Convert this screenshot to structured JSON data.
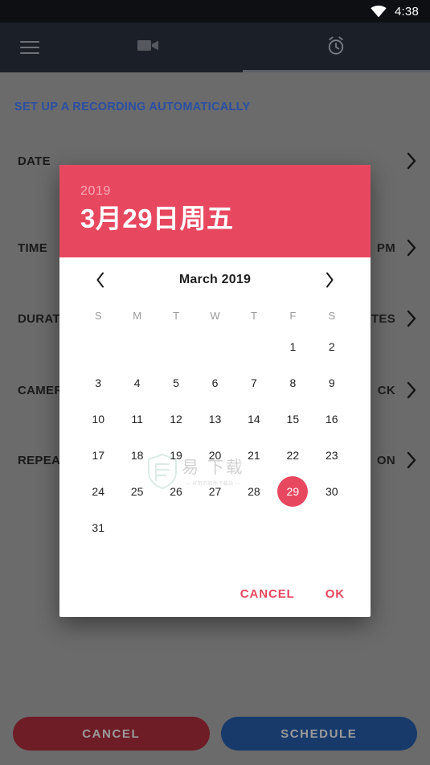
{
  "status_bar": {
    "time": "4:38",
    "wifi_icon": "wifi-icon"
  },
  "app_bar": {
    "menu_icon": "hamburger-menu-icon",
    "tabs": [
      {
        "icon": "video-camera-icon",
        "active": false
      },
      {
        "icon": "alarm-clock-icon",
        "active": true
      }
    ]
  },
  "main": {
    "section_title": "SET UP A RECORDING AUTOMATICALLY",
    "rows": [
      {
        "label": "DATE",
        "value": "",
        "chevron": "chevron-right-icon"
      },
      {
        "label": "TIME",
        "value": "PM",
        "chevron": "chevron-right-icon"
      },
      {
        "label": "DURATION",
        "value": "TES",
        "chevron": "chevron-right-icon"
      },
      {
        "label": "CAMERA",
        "value": "CK",
        "chevron": "chevron-right-icon"
      },
      {
        "label": "REPEAT",
        "value": "ON",
        "chevron": "chevron-right-icon"
      }
    ],
    "bottom_buttons": {
      "cancel_label": "CANCEL",
      "schedule_label": "SCHEDULE"
    }
  },
  "dialog": {
    "header": {
      "year": "2019",
      "date_label": "3月29日周五"
    },
    "calendar": {
      "prev_icon": "chevron-left-icon",
      "next_icon": "chevron-right-icon",
      "month_label": "March 2019",
      "day_headers": [
        "S",
        "M",
        "T",
        "W",
        "T",
        "F",
        "S"
      ],
      "leading_blanks": 5,
      "days": [
        1,
        2,
        3,
        4,
        5,
        6,
        7,
        8,
        9,
        10,
        11,
        12,
        13,
        14,
        15,
        16,
        17,
        18,
        19,
        20,
        21,
        22,
        23,
        24,
        25,
        26,
        27,
        28,
        29,
        30,
        31
      ],
      "selected_day": 29
    },
    "actions": {
      "cancel_label": "CANCEL",
      "ok_label": "OK"
    }
  },
  "watermark": {
    "main_text": "易 下载",
    "sub_text": "— 好用的软件下载站 —"
  },
  "colors": {
    "accent_red": "#e8485f",
    "section_blue": "#2b4fa3",
    "scrim_gray": "#6b6b6b",
    "appbar_dark": "#1b1f28",
    "statusbar_dark": "#0d0f13",
    "cancel_pill": "#6e1c26",
    "schedule_pill": "#173a6b"
  }
}
